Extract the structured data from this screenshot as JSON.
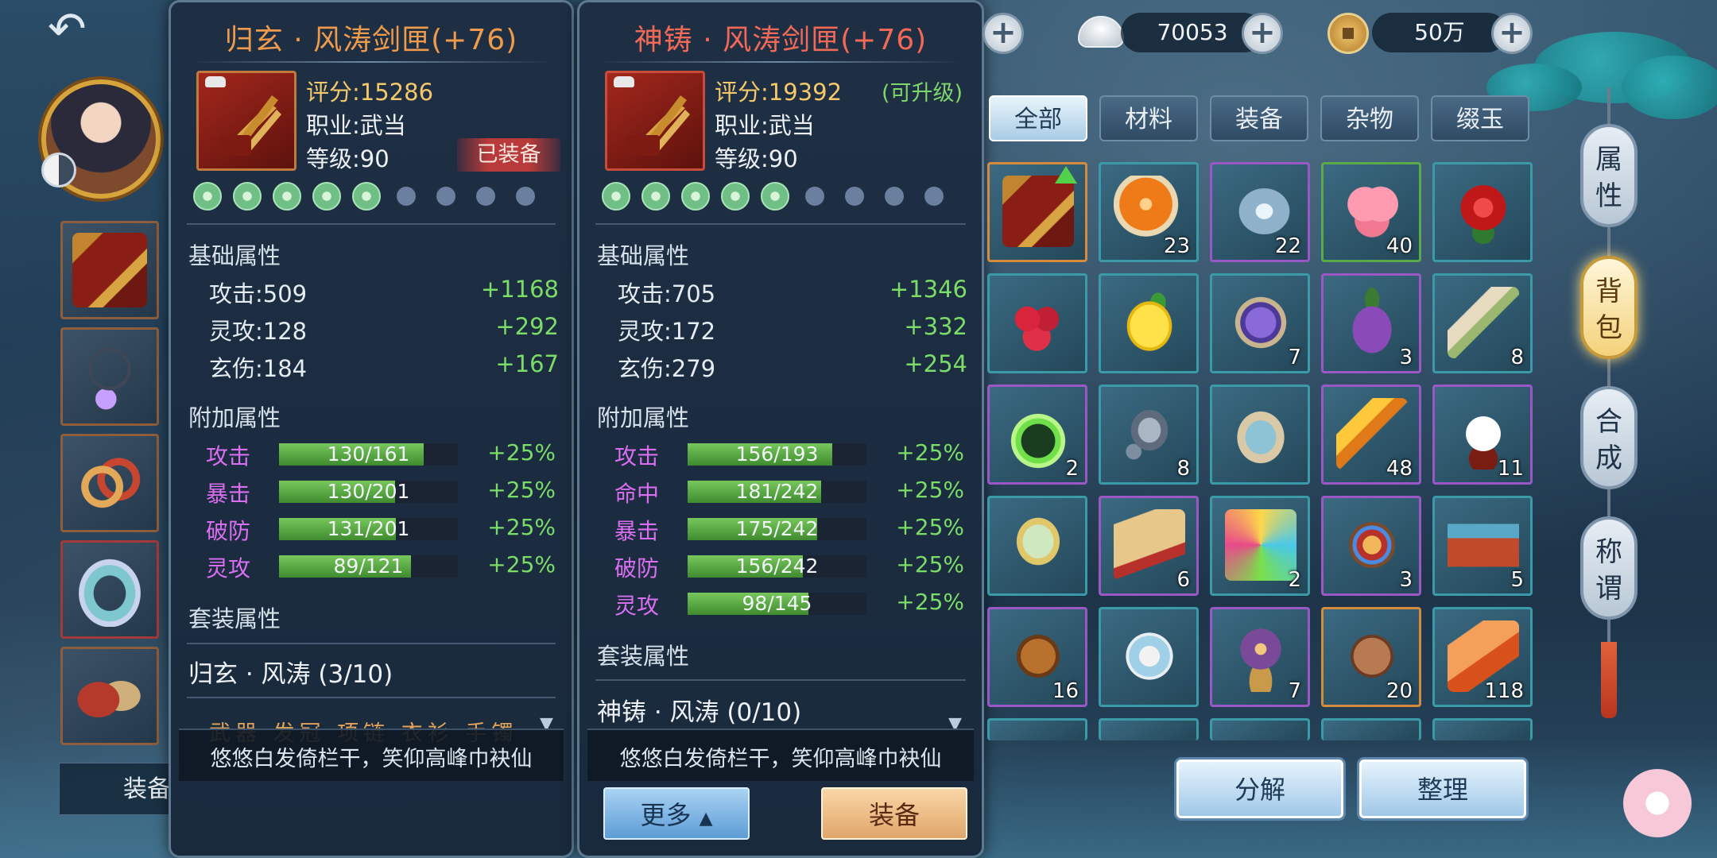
{
  "colors": {
    "score": "#f5c96a",
    "bonus_green": "#7bdc68",
    "title_orange": "#f09a4b",
    "title_red": "#f26a57",
    "extra_label_purple": "#d96ff0",
    "equipped_badge_red": "#b83a3a"
  },
  "equipment_sidebar": {
    "equip_label": "装备",
    "slots": [
      {
        "icon": "sword-box-icon"
      },
      {
        "icon": "necklace-icon"
      },
      {
        "icon": "bracelet-icon"
      },
      {
        "icon": "ring-icon"
      },
      {
        "icon": "gloves-icon"
      }
    ]
  },
  "current_item": {
    "title": "归玄 · 风涛剑匣(+76)",
    "score_text": "评分:15286",
    "class_text": "职业:武当",
    "level_text": "等级:90",
    "equipped_badge": "已装备",
    "gems_filled": 5,
    "gems_total": 9,
    "base_section": "基础属性",
    "base_stats": [
      {
        "label": "攻击:509",
        "bonus": "+1168"
      },
      {
        "label": "灵攻:128",
        "bonus": "+292"
      },
      {
        "label": "玄伤:184",
        "bonus": "+167"
      }
    ],
    "extra_section": "附加属性",
    "extra_stats": [
      {
        "label": "攻击",
        "text": "130/161",
        "fill": 0.807,
        "pct": "+25%"
      },
      {
        "label": "暴击",
        "text": "130/201",
        "fill": 0.647,
        "pct": "+25%"
      },
      {
        "label": "破防",
        "text": "131/201",
        "fill": 0.652,
        "pct": "+25%"
      },
      {
        "label": "灵攻",
        "text": "89/121",
        "fill": 0.736,
        "pct": "+25%"
      }
    ],
    "set_section": "套装属性",
    "set_name": "归玄 · 风涛 (3/10)",
    "set_pieces": "武器 发冠 项链 衣衫 手镯",
    "flavor": "悠悠白发倚栏干，笑仰高峰巾袂仙"
  },
  "compare_item": {
    "title": "神铸 · 风涛剑匣(+76)",
    "score_text": "评分:19392",
    "upgradeable": "(可升级)",
    "class_text": "职业:武当",
    "level_text": "等级:90",
    "gems_filled": 5,
    "gems_total": 9,
    "base_section": "基础属性",
    "base_stats": [
      {
        "label": "攻击:705",
        "bonus": "+1346"
      },
      {
        "label": "灵攻:172",
        "bonus": "+332"
      },
      {
        "label": "玄伤:279",
        "bonus": "+254"
      }
    ],
    "extra_section": "附加属性",
    "extra_stats": [
      {
        "label": "攻击",
        "text": "156/193",
        "fill": 0.808,
        "pct": "+25%"
      },
      {
        "label": "命中",
        "text": "181/242",
        "fill": 0.748,
        "pct": "+25%"
      },
      {
        "label": "暴击",
        "text": "175/242",
        "fill": 0.723,
        "pct": "+25%"
      },
      {
        "label": "破防",
        "text": "156/242",
        "fill": 0.645,
        "pct": "+25%"
      },
      {
        "label": "灵攻",
        "text": "98/145",
        "fill": 0.676,
        "pct": "+25%"
      }
    ],
    "set_section": "套装属性",
    "set_name": "神铸 · 风涛 (0/10)",
    "flavor": "悠悠白发倚栏干，笑仰高峰巾袂仙",
    "more_button": "更多",
    "equip_button": "装备"
  },
  "currency": {
    "silver_amount": "70053",
    "copper_amount": "50万"
  },
  "bag": {
    "tabs": [
      "全部",
      "材料",
      "装备",
      "杂物",
      "缀玉"
    ],
    "active_tab": 0,
    "items": [
      {
        "icon": "sword-box-icon",
        "count": "",
        "rarity": "orange",
        "upgrade": true
      },
      {
        "icon": "orange-orb-icon",
        "count": "23",
        "rarity": "teal"
      },
      {
        "icon": "water-drop-icon",
        "count": "22",
        "rarity": "purple"
      },
      {
        "icon": "heart-jelly-icon",
        "count": "40",
        "rarity": "green"
      },
      {
        "icon": "rose-icon",
        "count": "",
        "rarity": "teal"
      },
      {
        "icon": "raspberry-icon",
        "count": "",
        "rarity": "teal"
      },
      {
        "icon": "lemon-icon",
        "count": "",
        "rarity": "teal"
      },
      {
        "icon": "purple-seed-icon",
        "count": "7",
        "rarity": "teal"
      },
      {
        "icon": "eggplant-icon",
        "count": "3",
        "rarity": "purple"
      },
      {
        "icon": "root-herb-icon",
        "count": "8",
        "rarity": "teal"
      },
      {
        "icon": "green-spirit-icon",
        "count": "2",
        "rarity": "purple"
      },
      {
        "icon": "ore-chunk-icon",
        "count": "8",
        "rarity": "teal"
      },
      {
        "icon": "blue-powder-icon",
        "count": "",
        "rarity": "teal"
      },
      {
        "icon": "golden-feather-icon",
        "count": "48",
        "rarity": "purple"
      },
      {
        "icon": "panda-icon",
        "count": "11",
        "rarity": "purple"
      },
      {
        "icon": "jade-box-icon",
        "count": "",
        "rarity": "teal"
      },
      {
        "icon": "paw-scroll-icon",
        "count": "6",
        "rarity": "purple"
      },
      {
        "icon": "color-powder-icon",
        "count": "2",
        "rarity": "teal"
      },
      {
        "icon": "gem-box-icon",
        "count": "3",
        "rarity": "purple"
      },
      {
        "icon": "treasure-chest-icon",
        "count": "5",
        "rarity": "teal"
      },
      {
        "icon": "saddle-icon",
        "count": "16",
        "rarity": "purple"
      },
      {
        "icon": "pill-box-icon",
        "count": "",
        "rarity": "teal"
      },
      {
        "icon": "crystal-ball-icon",
        "count": "7",
        "rarity": "purple"
      },
      {
        "icon": "bean-icon",
        "count": "20",
        "rarity": "orange"
      },
      {
        "icon": "amber-shard-icon",
        "count": "118",
        "rarity": "teal"
      }
    ]
  },
  "side_tabs": [
    {
      "label": "属性",
      "active": false
    },
    {
      "label": "背包",
      "active": true
    },
    {
      "label": "合成",
      "active": false
    },
    {
      "label": "称谓",
      "active": false
    }
  ],
  "bottom_buttons": {
    "decompose": "分解",
    "sort": "整理"
  }
}
